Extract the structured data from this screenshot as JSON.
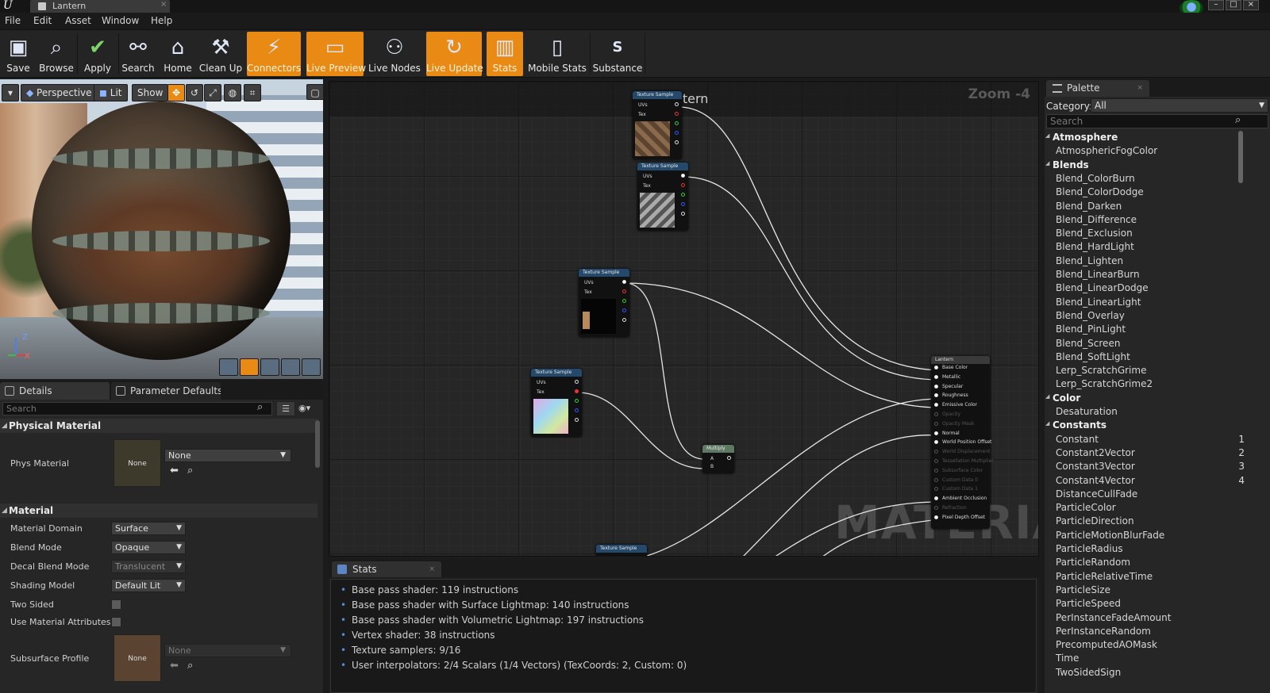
{
  "window": {
    "document_tab": "Lantern"
  },
  "menu": [
    "File",
    "Edit",
    "Asset",
    "Window",
    "Help"
  ],
  "toolbar": {
    "buttons": [
      {
        "label": "Save",
        "icon": "floppy-icon",
        "active": false
      },
      {
        "label": "Browse",
        "icon": "magnifier-icon",
        "active": false
      },
      {
        "label": "Apply",
        "icon": "checkmark-icon",
        "active": false
      },
      {
        "label": "Search",
        "icon": "binoculars-icon",
        "active": false
      },
      {
        "label": "Home",
        "icon": "house-icon",
        "active": false
      },
      {
        "label": "Clean Up",
        "icon": "broom-icon",
        "active": false
      },
      {
        "label": "Connectors",
        "icon": "connectors-icon",
        "active": true
      },
      {
        "label": "Live Preview",
        "icon": "monitor-icon",
        "active": true
      },
      {
        "label": "Live Nodes",
        "icon": "nodes-icon",
        "active": false
      },
      {
        "label": "Live Update",
        "icon": "refresh-icon",
        "active": true
      },
      {
        "label": "Stats",
        "icon": "bar-stats-icon",
        "active": true
      },
      {
        "label": "Mobile Stats",
        "icon": "mobile-icon",
        "active": false
      },
      {
        "label": "Substance",
        "icon": "substance-icon",
        "active": false
      }
    ]
  },
  "viewport": {
    "perspective": "Perspective",
    "lit": "Lit",
    "show": "Show",
    "axis_z": "Z",
    "axis_x": "X"
  },
  "details": {
    "tab_details": "Details",
    "tab_params": "Parameter Defaults",
    "search_placeholder": "Search",
    "section_physical": "Physical Material",
    "phys_material_label": "Phys Material",
    "phys_material_swatch": "None",
    "phys_material_value": "None",
    "section_material": "Material",
    "rows": [
      {
        "label": "Material Domain",
        "value": "Surface",
        "enabled": true
      },
      {
        "label": "Blend Mode",
        "value": "Opaque",
        "enabled": true
      },
      {
        "label": "Decal Blend Mode",
        "value": "Translucent",
        "enabled": false
      },
      {
        "label": "Shading Model",
        "value": "Default Lit",
        "enabled": true
      }
    ],
    "two_sided": "Two Sided",
    "use_material_attributes": "Use Material Attributes",
    "subsurface_profile": "Subsurface Profile",
    "subsurface_swatch": "None",
    "subsurface_value": "None"
  },
  "graph": {
    "zoom": "Zoom -4",
    "title": "Lantern",
    "watermark": "MATERIAL",
    "texture_sample": "Texture Sample",
    "pin_uvs": "UVs",
    "pin_tex": "Tex",
    "multiply": "Multiply",
    "pin_a": "A",
    "pin_b": "B",
    "result_title": "Lantern",
    "result_pins": [
      {
        "label": "Base Color",
        "enabled": true
      },
      {
        "label": "Metallic",
        "enabled": true
      },
      {
        "label": "Specular",
        "enabled": true
      },
      {
        "label": "Roughness",
        "enabled": true
      },
      {
        "label": "Emissive Color",
        "enabled": true
      },
      {
        "label": "Opacity",
        "enabled": false
      },
      {
        "label": "Opacity Mask",
        "enabled": false
      },
      {
        "label": "Normal",
        "enabled": true
      },
      {
        "label": "World Position Offset",
        "enabled": true
      },
      {
        "label": "World Displacement",
        "enabled": false
      },
      {
        "label": "Tessellation Multiplier",
        "enabled": false
      },
      {
        "label": "Subsurface Color",
        "enabled": false
      },
      {
        "label": "Custom Data 0",
        "enabled": false
      },
      {
        "label": "Custom Data 1",
        "enabled": false
      },
      {
        "label": "Ambient Occlusion",
        "enabled": true
      },
      {
        "label": "Refraction",
        "enabled": false
      },
      {
        "label": "Pixel Depth Offset",
        "enabled": true
      }
    ]
  },
  "stats": {
    "tab": "Stats",
    "lines": [
      "Base pass shader: 119 instructions",
      "Base pass shader with Surface Lightmap: 140 instructions",
      "Base pass shader with Volumetric Lightmap: 197 instructions",
      "Vertex shader: 38 instructions",
      "Texture samplers: 9/16",
      "User interpolators: 2/4 Scalars (1/4 Vectors) (TexCoords: 2, Custom: 0)"
    ]
  },
  "palette": {
    "tab": "Palette",
    "category_label": "Category:",
    "category_value": "All",
    "search_placeholder": "Search",
    "groups": [
      {
        "name": "Atmosphere",
        "items": [
          {
            "label": "AtmosphericFogColor",
            "hotkey": ""
          }
        ]
      },
      {
        "name": "Blends",
        "items": [
          {
            "label": "Blend_ColorBurn",
            "hotkey": ""
          },
          {
            "label": "Blend_ColorDodge",
            "hotkey": ""
          },
          {
            "label": "Blend_Darken",
            "hotkey": ""
          },
          {
            "label": "Blend_Difference",
            "hotkey": ""
          },
          {
            "label": "Blend_Exclusion",
            "hotkey": ""
          },
          {
            "label": "Blend_HardLight",
            "hotkey": ""
          },
          {
            "label": "Blend_Lighten",
            "hotkey": ""
          },
          {
            "label": "Blend_LinearBurn",
            "hotkey": ""
          },
          {
            "label": "Blend_LinearDodge",
            "hotkey": ""
          },
          {
            "label": "Blend_LinearLight",
            "hotkey": ""
          },
          {
            "label": "Blend_Overlay",
            "hotkey": ""
          },
          {
            "label": "Blend_PinLight",
            "hotkey": ""
          },
          {
            "label": "Blend_Screen",
            "hotkey": ""
          },
          {
            "label": "Blend_SoftLight",
            "hotkey": ""
          },
          {
            "label": "Lerp_ScratchGrime",
            "hotkey": ""
          },
          {
            "label": "Lerp_ScratchGrime2",
            "hotkey": ""
          }
        ]
      },
      {
        "name": "Color",
        "items": [
          {
            "label": "Desaturation",
            "hotkey": ""
          }
        ]
      },
      {
        "name": "Constants",
        "items": [
          {
            "label": "Constant",
            "hotkey": "1"
          },
          {
            "label": "Constant2Vector",
            "hotkey": "2"
          },
          {
            "label": "Constant3Vector",
            "hotkey": "3"
          },
          {
            "label": "Constant4Vector",
            "hotkey": "4"
          },
          {
            "label": "DistanceCullFade",
            "hotkey": ""
          },
          {
            "label": "ParticleColor",
            "hotkey": ""
          },
          {
            "label": "ParticleDirection",
            "hotkey": ""
          },
          {
            "label": "ParticleMotionBlurFade",
            "hotkey": ""
          },
          {
            "label": "ParticleRadius",
            "hotkey": ""
          },
          {
            "label": "ParticleRandom",
            "hotkey": ""
          },
          {
            "label": "ParticleRelativeTime",
            "hotkey": ""
          },
          {
            "label": "ParticleSize",
            "hotkey": ""
          },
          {
            "label": "ParticleSpeed",
            "hotkey": ""
          },
          {
            "label": "PerInstanceFadeAmount",
            "hotkey": ""
          },
          {
            "label": "PerInstanceRandom",
            "hotkey": ""
          },
          {
            "label": "PrecomputedAOMask",
            "hotkey": ""
          },
          {
            "label": "Time",
            "hotkey": ""
          },
          {
            "label": "TwoSidedSign",
            "hotkey": ""
          }
        ]
      }
    ]
  }
}
